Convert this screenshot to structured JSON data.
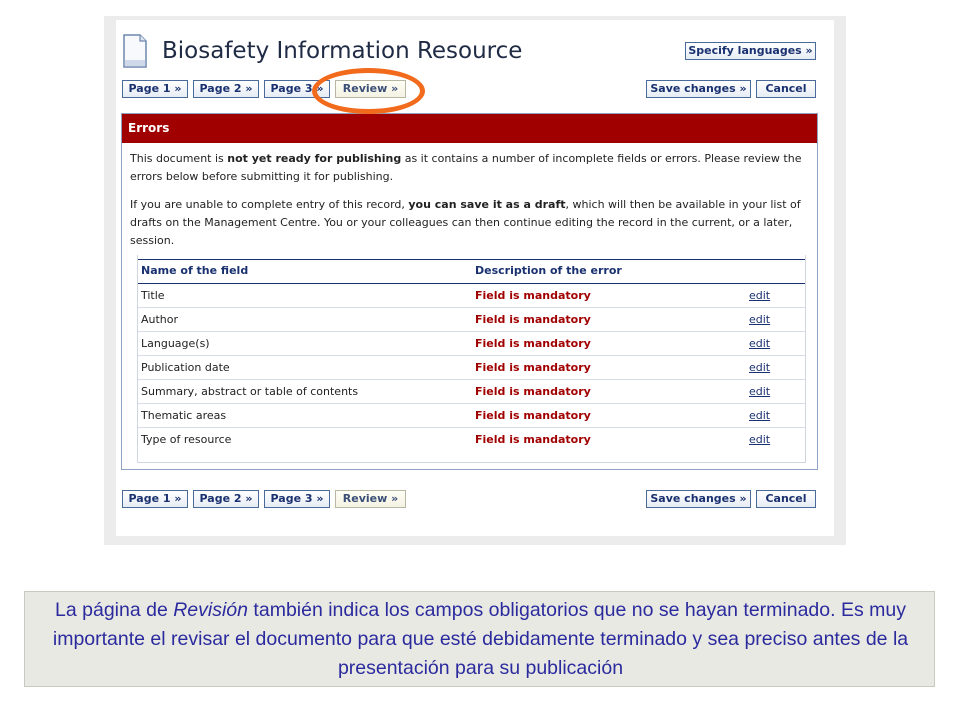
{
  "window": {
    "title": "Biosafety Information Resource"
  },
  "icons": {
    "document": "document-icon"
  },
  "colors": {
    "error_header_bg": "#a10000",
    "error_text": "#a10000",
    "highlight_circle": "#f26a1b",
    "link": "#1a3170"
  },
  "toolbar_top": {
    "page1": "Page 1 »",
    "page2": "Page 2 »",
    "page3": "Page 3 »",
    "review": "Review »",
    "save": "Save changes »",
    "cancel": "Cancel",
    "specify_languages": "Specify languages »"
  },
  "toolbar_bottom": {
    "page1": "Page 1 »",
    "page2": "Page 2 »",
    "page3": "Page 3 »",
    "review": "Review »",
    "save": "Save changes »",
    "cancel": "Cancel"
  },
  "errors": {
    "header": "Errors",
    "p1_a": "This document is ",
    "p1_b": "not yet ready for publishing",
    "p1_c": " as it contains a number of incomplete fields or errors. Please review the errors below before submitting it for publishing.",
    "p2_a": "If you are unable to complete entry of this record, ",
    "p2_b": "you can save it as a draft",
    "p2_c": ", which will then be available in your list of drafts on the Management Centre. You or your colleagues can then continue editing the record in the current, or a later, session.",
    "table": {
      "col_name": "Name of the field",
      "col_desc": "Description of the error",
      "rows": [
        {
          "name": "Title",
          "error": "Field is mandatory",
          "action": "edit"
        },
        {
          "name": "Author",
          "error": "Field is mandatory",
          "action": "edit"
        },
        {
          "name": "Language(s)",
          "error": "Field is mandatory",
          "action": "edit"
        },
        {
          "name": "Publication date",
          "error": "Field is mandatory",
          "action": "edit"
        },
        {
          "name": "Summary, abstract or table of contents",
          "error": "Field is mandatory",
          "action": "edit"
        },
        {
          "name": "Thematic areas",
          "error": "Field is mandatory",
          "action": "edit"
        },
        {
          "name": "Type of resource",
          "error": "Field is mandatory",
          "action": "edit"
        }
      ]
    }
  },
  "caption": {
    "part1": "La página de ",
    "part2": "Revisión",
    "part3": " también indica los campos obligatorios que no se hayan terminado. Es muy importante el revisar el documento para que esté debidamente terminado y sea preciso antes de la presentación para su publicación"
  }
}
